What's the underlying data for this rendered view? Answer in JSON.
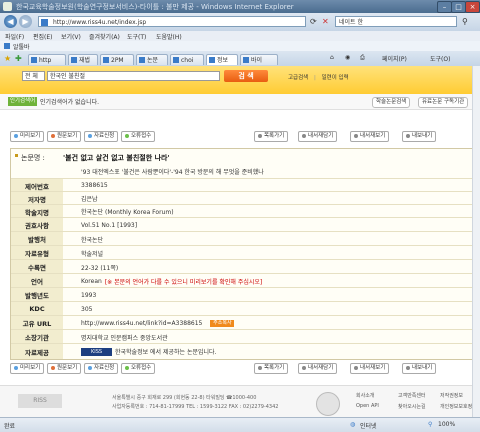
{
  "browser": {
    "window_title": "한국교육학술정보원(학술연구정보서비스)-타이틀 : 불만 제공 - Windows Internet Explorer",
    "address": "http://www.riss4u.net/index.jsp",
    "search_text": "네이트 한",
    "menu": [
      "파일(F)",
      "편집(E)",
      "보기(V)",
      "즐겨찾기(A)",
      "도구(T)",
      "도움말(H)"
    ],
    "favorites_label": "알툴바",
    "tabs": [
      "http",
      "재법",
      "2PM",
      "논문",
      "choi",
      "정보",
      "바이"
    ],
    "page_menu": "페이지(P)",
    "tools_menu": "도구(O)"
  },
  "site": {
    "scope": "전 체",
    "query": "한국인 불친절",
    "search_button": "검 색",
    "adv_links": [
      "고급검색",
      "일련이 입력"
    ],
    "popular_badge": "인기검색어",
    "popular_text": "인기검색어가 없습니다.",
    "pills": [
      "학술논문검색",
      "유료논문 구독기관"
    ]
  },
  "toolbar_top": {
    "left": [
      "미리보기",
      "원문보기",
      "자료신청",
      "오류접수"
    ],
    "right": [
      "목록가기",
      "내서재담기",
      "내서재보기",
      "내보내기"
    ]
  },
  "record": {
    "title_label": "논문명 :",
    "title": "'불건 없고 살건 없고 불친절한 나라'",
    "subtitle": "'93 대전엑스포 '불건은 사람뿐이다'-'94 한국 방문의 해 무엇을 준비했나",
    "rows": [
      {
        "label": "제어번호",
        "value": "3388615"
      },
      {
        "label": "저자명",
        "value": "김은남"
      },
      {
        "label": "학술지명",
        "value": "한국논단 (Monthly Korea Forum)"
      },
      {
        "label": "권호사항",
        "value": "Vol.51 No.1 [1993]"
      },
      {
        "label": "발행처",
        "value": "한국논단"
      },
      {
        "label": "자료유형",
        "value": "학술저널"
      },
      {
        "label": "수록면",
        "value": "22-32 (11쪽)"
      },
      {
        "label": "언어",
        "value": "Korean",
        "note": "[※ 본문의 언어가 다를 수 있으니 미리보기를 확인해 주십시오]"
      },
      {
        "label": "발행년도",
        "value": "1993"
      },
      {
        "label": "KDC",
        "value": "305"
      },
      {
        "label": "고유 URL",
        "value": "http://www.riss4u.net/link?id=A3388615",
        "button": "주소복사"
      },
      {
        "label": "소장기관",
        "value": "명지대학교 인문캠퍼스 중앙도서관"
      },
      {
        "label": "자료제공",
        "badge": "KISS",
        "value": "한국학술정보 에서 제공하는 논문입니다."
      }
    ]
  },
  "toolbar_bottom": {
    "left": [
      "미리보기",
      "원문보기",
      "자료신청",
      "오류접수"
    ],
    "right": [
      "목록가기",
      "내서재담기",
      "내서재보기",
      "내보내기"
    ]
  },
  "footer": {
    "logo": "RISS",
    "addr1": "서울특별시 중구 회재로 299 (회현동 22-8) 타워빌딩  ☎1000-400",
    "addr2": "사업자등록번호 : 714-81-17999  TEL : 1599-3122  FAX : 02)2279-4342",
    "links": [
      "회사소개",
      "고객만족센터",
      "저작권정보",
      "Open API",
      "찾아오시는길",
      "개인정보보호정책"
    ]
  },
  "status": {
    "left": "완료",
    "zone": "인터넷",
    "zoom": "100%"
  },
  "colors": {
    "header_yellow": "#ffcc33",
    "search_orange": "#e85d10",
    "label_bg": "#f2edcf",
    "note_red": "#cc0000"
  }
}
